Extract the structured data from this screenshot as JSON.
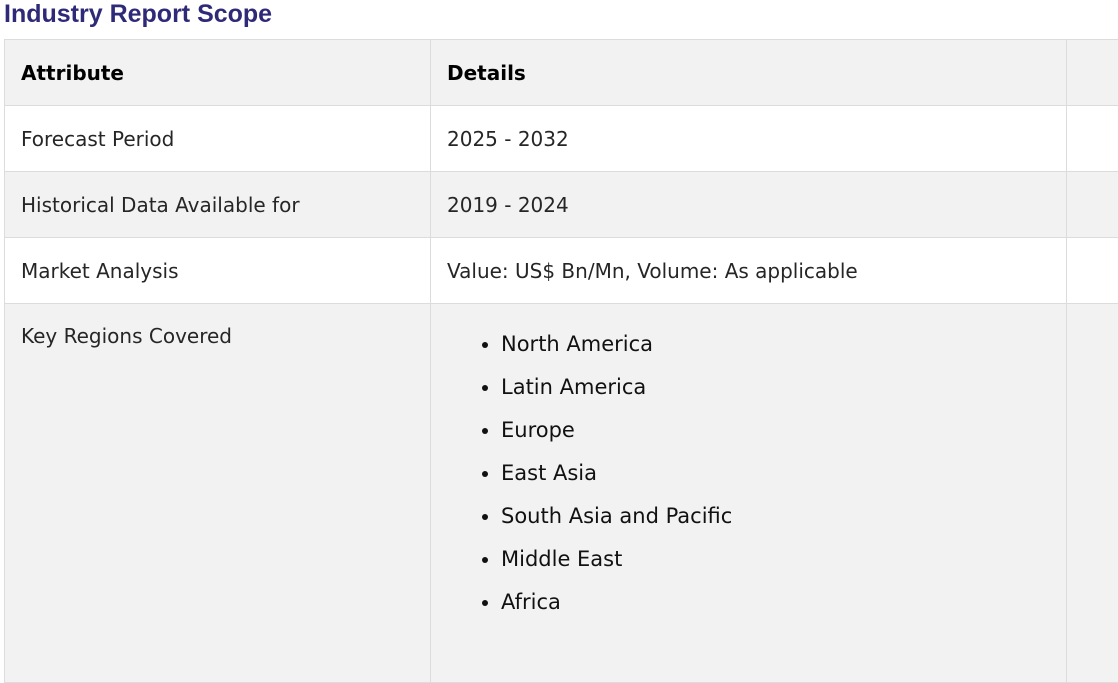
{
  "page": {
    "title": "Industry Report Scope"
  },
  "table": {
    "headers": {
      "attribute": "Attribute",
      "details": "Details",
      "extra": ""
    },
    "rows": [
      {
        "attribute": "Forecast Period",
        "details": "2025 - 2032"
      },
      {
        "attribute": "Historical Data Available for",
        "details": "2019 - 2024"
      },
      {
        "attribute": "Market Analysis",
        "details": "Value: US$ Bn/Mn, Volume: As applicable"
      }
    ],
    "regions": {
      "attribute": "Key Regions Covered",
      "items": [
        "North America",
        "Latin America",
        "Europe",
        "East Asia",
        "South Asia and Pacific",
        "Middle East",
        "Africa"
      ]
    }
  },
  "colors": {
    "title": "#2e2a78",
    "header_bg": "#f2f2f2",
    "row_alt_bg": "#f2f2f2",
    "border": "#dcdcdc"
  }
}
